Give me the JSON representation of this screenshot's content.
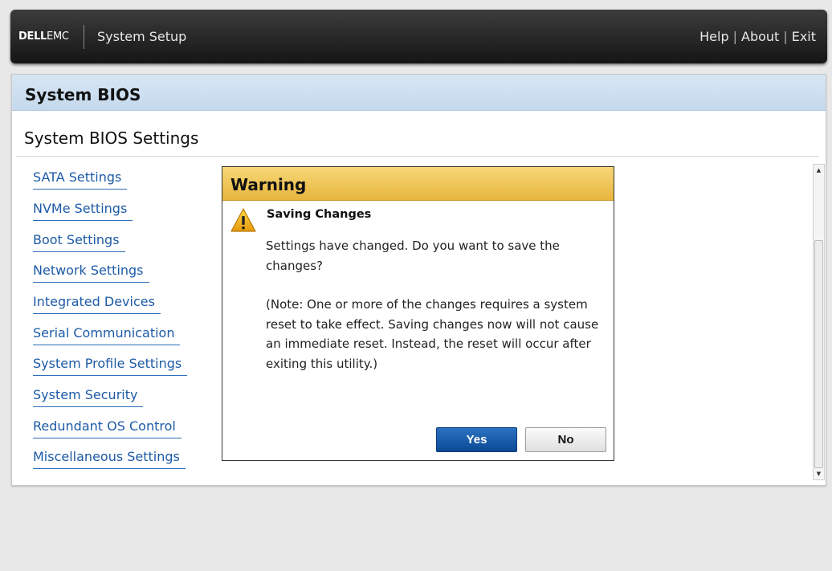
{
  "header": {
    "logo_dell": "DELL",
    "logo_emc": "EMC",
    "title": "System Setup",
    "links": [
      "Help",
      "About",
      "Exit"
    ],
    "separator": "|"
  },
  "panel": {
    "title": "System BIOS",
    "section_title": "System BIOS Settings",
    "menu": [
      "SATA Settings",
      "NVMe Settings",
      "Boot Settings",
      "Network Settings",
      "Integrated Devices",
      "Serial Communication",
      "System Profile Settings",
      "System Security",
      "Redundant OS Control",
      "Miscellaneous Settings"
    ]
  },
  "dialog": {
    "title": "Warning",
    "subtitle": "Saving Changes",
    "message": "Settings have changed. Do you want to save the changes?",
    "note": "(Note: One or more of the changes requires a system reset to take effect. Saving changes now will not cause an immediate reset. Instead, the reset will occur after exiting this utility.)",
    "yes_label": "Yes",
    "no_label": "No",
    "icon": "warning-icon"
  },
  "colors": {
    "header_bg": "#1f1f1f",
    "title_bar": "#cfe0f1",
    "link": "#1d5aa6",
    "warning_header": "#f0c75a",
    "primary_button": "#1a5aa8"
  }
}
